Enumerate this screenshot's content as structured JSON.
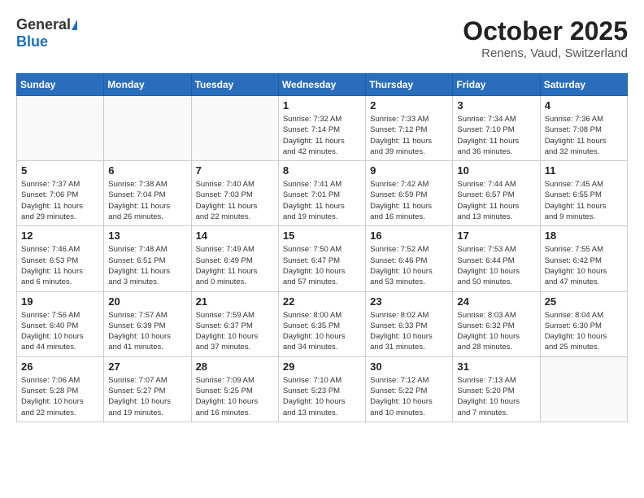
{
  "header": {
    "logo_general": "General",
    "logo_blue": "Blue",
    "title": "October 2025",
    "subtitle": "Renens, Vaud, Switzerland"
  },
  "days_of_week": [
    "Sunday",
    "Monday",
    "Tuesday",
    "Wednesday",
    "Thursday",
    "Friday",
    "Saturday"
  ],
  "weeks": [
    [
      {
        "day": "",
        "empty": true
      },
      {
        "day": "",
        "empty": true
      },
      {
        "day": "",
        "empty": true
      },
      {
        "day": "1",
        "lines": [
          "Sunrise: 7:32 AM",
          "Sunset: 7:14 PM",
          "Daylight: 11 hours",
          "and 42 minutes."
        ]
      },
      {
        "day": "2",
        "lines": [
          "Sunrise: 7:33 AM",
          "Sunset: 7:12 PM",
          "Daylight: 11 hours",
          "and 39 minutes."
        ]
      },
      {
        "day": "3",
        "lines": [
          "Sunrise: 7:34 AM",
          "Sunset: 7:10 PM",
          "Daylight: 11 hours",
          "and 36 minutes."
        ]
      },
      {
        "day": "4",
        "lines": [
          "Sunrise: 7:36 AM",
          "Sunset: 7:08 PM",
          "Daylight: 11 hours",
          "and 32 minutes."
        ]
      }
    ],
    [
      {
        "day": "5",
        "lines": [
          "Sunrise: 7:37 AM",
          "Sunset: 7:06 PM",
          "Daylight: 11 hours",
          "and 29 minutes."
        ]
      },
      {
        "day": "6",
        "lines": [
          "Sunrise: 7:38 AM",
          "Sunset: 7:04 PM",
          "Daylight: 11 hours",
          "and 26 minutes."
        ]
      },
      {
        "day": "7",
        "lines": [
          "Sunrise: 7:40 AM",
          "Sunset: 7:03 PM",
          "Daylight: 11 hours",
          "and 22 minutes."
        ]
      },
      {
        "day": "8",
        "lines": [
          "Sunrise: 7:41 AM",
          "Sunset: 7:01 PM",
          "Daylight: 11 hours",
          "and 19 minutes."
        ]
      },
      {
        "day": "9",
        "lines": [
          "Sunrise: 7:42 AM",
          "Sunset: 6:59 PM",
          "Daylight: 11 hours",
          "and 16 minutes."
        ]
      },
      {
        "day": "10",
        "lines": [
          "Sunrise: 7:44 AM",
          "Sunset: 6:57 PM",
          "Daylight: 11 hours",
          "and 13 minutes."
        ]
      },
      {
        "day": "11",
        "lines": [
          "Sunrise: 7:45 AM",
          "Sunset: 6:55 PM",
          "Daylight: 11 hours",
          "and 9 minutes."
        ]
      }
    ],
    [
      {
        "day": "12",
        "lines": [
          "Sunrise: 7:46 AM",
          "Sunset: 6:53 PM",
          "Daylight: 11 hours",
          "and 6 minutes."
        ]
      },
      {
        "day": "13",
        "lines": [
          "Sunrise: 7:48 AM",
          "Sunset: 6:51 PM",
          "Daylight: 11 hours",
          "and 3 minutes."
        ]
      },
      {
        "day": "14",
        "lines": [
          "Sunrise: 7:49 AM",
          "Sunset: 6:49 PM",
          "Daylight: 11 hours",
          "and 0 minutes."
        ]
      },
      {
        "day": "15",
        "lines": [
          "Sunrise: 7:50 AM",
          "Sunset: 6:47 PM",
          "Daylight: 10 hours",
          "and 57 minutes."
        ]
      },
      {
        "day": "16",
        "lines": [
          "Sunrise: 7:52 AM",
          "Sunset: 6:46 PM",
          "Daylight: 10 hours",
          "and 53 minutes."
        ]
      },
      {
        "day": "17",
        "lines": [
          "Sunrise: 7:53 AM",
          "Sunset: 6:44 PM",
          "Daylight: 10 hours",
          "and 50 minutes."
        ]
      },
      {
        "day": "18",
        "lines": [
          "Sunrise: 7:55 AM",
          "Sunset: 6:42 PM",
          "Daylight: 10 hours",
          "and 47 minutes."
        ]
      }
    ],
    [
      {
        "day": "19",
        "lines": [
          "Sunrise: 7:56 AM",
          "Sunset: 6:40 PM",
          "Daylight: 10 hours",
          "and 44 minutes."
        ]
      },
      {
        "day": "20",
        "lines": [
          "Sunrise: 7:57 AM",
          "Sunset: 6:39 PM",
          "Daylight: 10 hours",
          "and 41 minutes."
        ]
      },
      {
        "day": "21",
        "lines": [
          "Sunrise: 7:59 AM",
          "Sunset: 6:37 PM",
          "Daylight: 10 hours",
          "and 37 minutes."
        ]
      },
      {
        "day": "22",
        "lines": [
          "Sunrise: 8:00 AM",
          "Sunset: 6:35 PM",
          "Daylight: 10 hours",
          "and 34 minutes."
        ]
      },
      {
        "day": "23",
        "lines": [
          "Sunrise: 8:02 AM",
          "Sunset: 6:33 PM",
          "Daylight: 10 hours",
          "and 31 minutes."
        ]
      },
      {
        "day": "24",
        "lines": [
          "Sunrise: 8:03 AM",
          "Sunset: 6:32 PM",
          "Daylight: 10 hours",
          "and 28 minutes."
        ]
      },
      {
        "day": "25",
        "lines": [
          "Sunrise: 8:04 AM",
          "Sunset: 6:30 PM",
          "Daylight: 10 hours",
          "and 25 minutes."
        ]
      }
    ],
    [
      {
        "day": "26",
        "lines": [
          "Sunrise: 7:06 AM",
          "Sunset: 5:28 PM",
          "Daylight: 10 hours",
          "and 22 minutes."
        ]
      },
      {
        "day": "27",
        "lines": [
          "Sunrise: 7:07 AM",
          "Sunset: 5:27 PM",
          "Daylight: 10 hours",
          "and 19 minutes."
        ]
      },
      {
        "day": "28",
        "lines": [
          "Sunrise: 7:09 AM",
          "Sunset: 5:25 PM",
          "Daylight: 10 hours",
          "and 16 minutes."
        ]
      },
      {
        "day": "29",
        "lines": [
          "Sunrise: 7:10 AM",
          "Sunset: 5:23 PM",
          "Daylight: 10 hours",
          "and 13 minutes."
        ]
      },
      {
        "day": "30",
        "lines": [
          "Sunrise: 7:12 AM",
          "Sunset: 5:22 PM",
          "Daylight: 10 hours",
          "and 10 minutes."
        ]
      },
      {
        "day": "31",
        "lines": [
          "Sunrise: 7:13 AM",
          "Sunset: 5:20 PM",
          "Daylight: 10 hours",
          "and 7 minutes."
        ]
      },
      {
        "day": "",
        "empty": true
      }
    ]
  ]
}
